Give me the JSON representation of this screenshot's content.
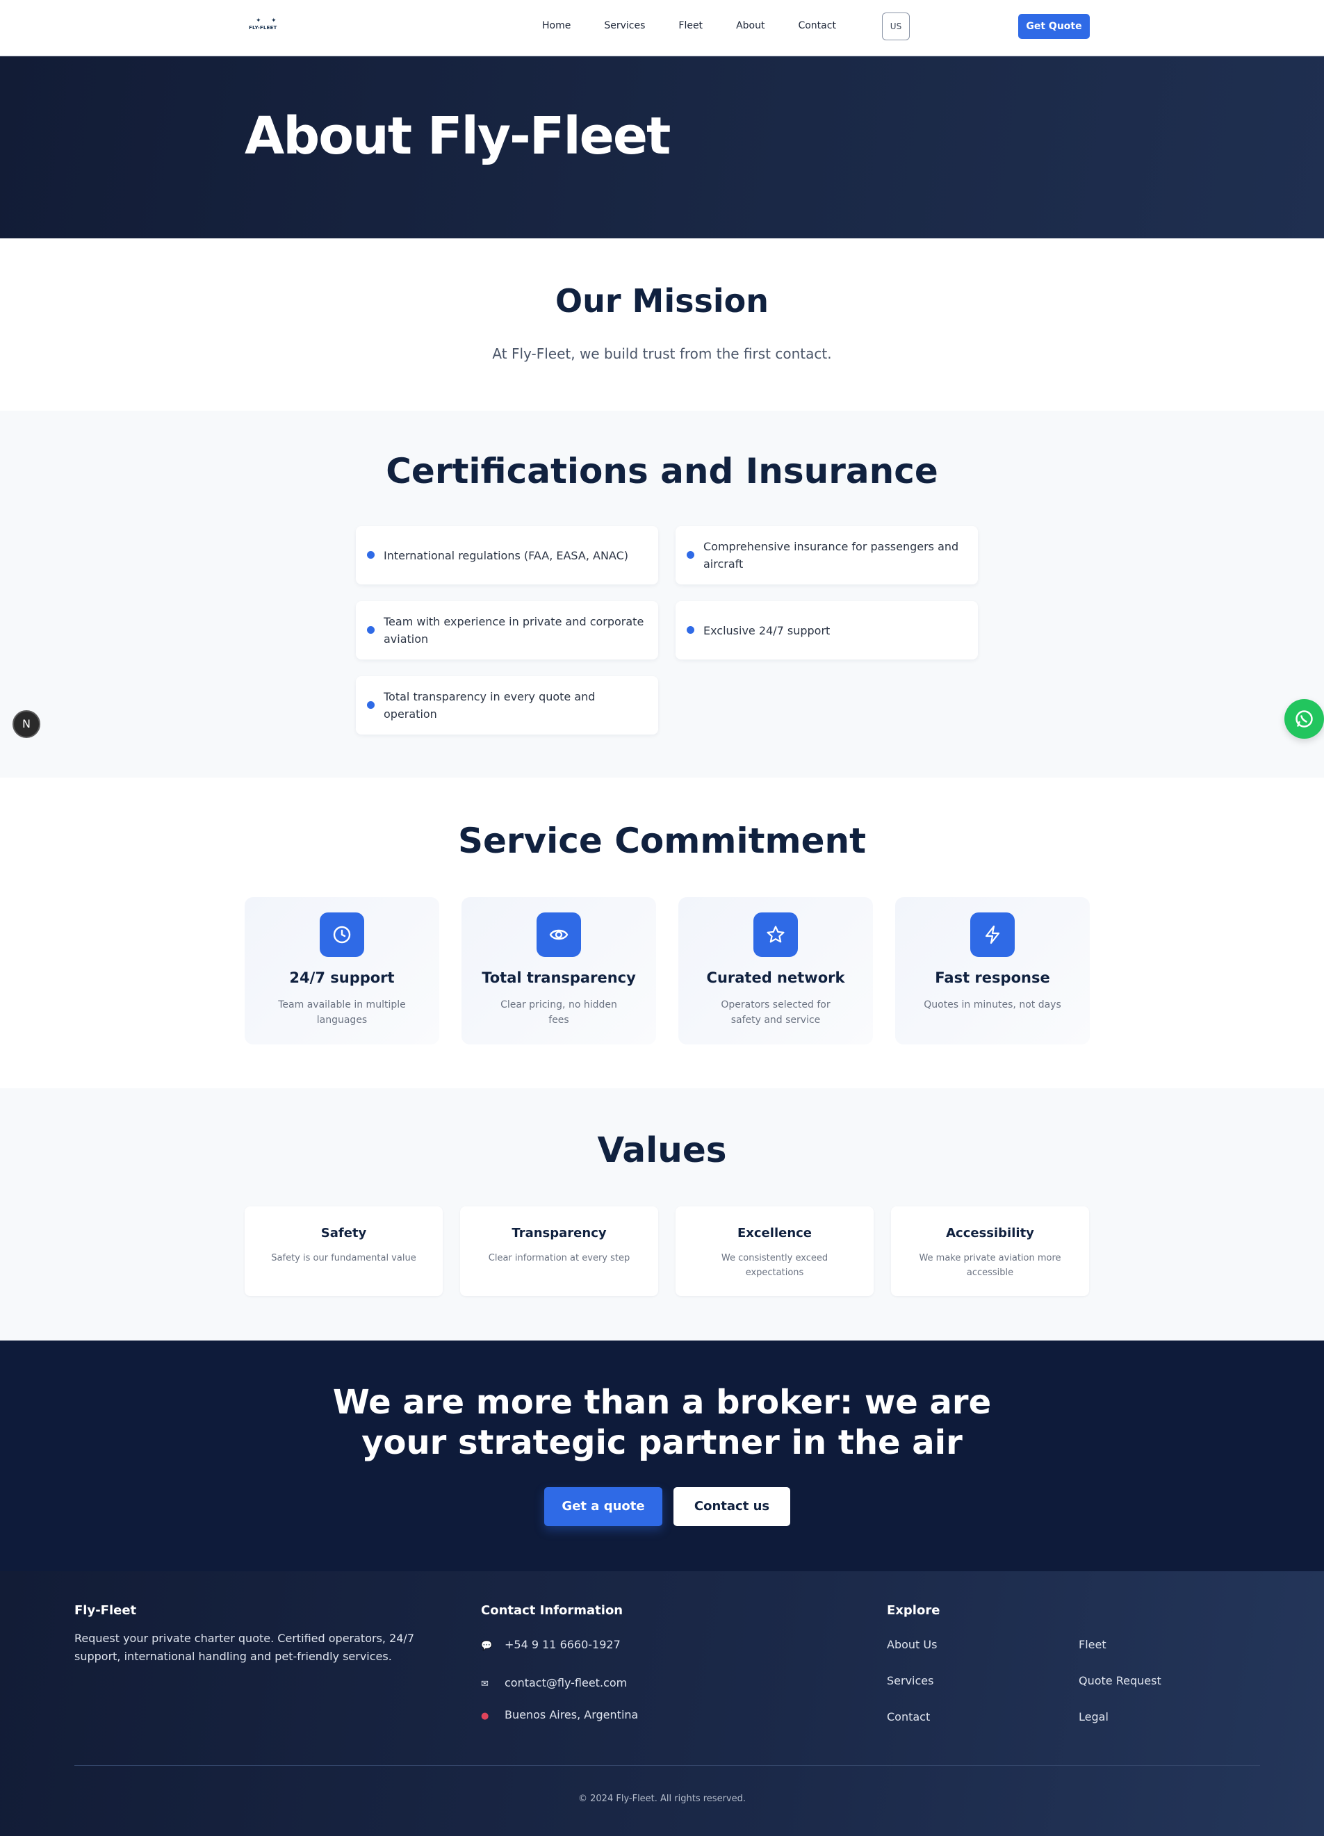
{
  "nav": {
    "logo_text": "FLY-FLEET",
    "links": [
      "Home",
      "Services",
      "Fleet",
      "About",
      "Contact"
    ],
    "lang": "US",
    "cta": "Get Quote"
  },
  "hero": {
    "title": "About Fly-Fleet"
  },
  "mission": {
    "title": "Our Mission",
    "text": "At Fly-Fleet, we build trust from the first contact."
  },
  "certs": {
    "title": "Certifications and Insurance",
    "items": [
      "International regulations (FAA, EASA, ANAC)",
      "Comprehensive insurance for passengers and aircraft",
      "Team with experience in private and corporate aviation",
      "Exclusive 24/7 support",
      "Total transparency in every quote and operation"
    ]
  },
  "badges": {
    "n": "N"
  },
  "service": {
    "title": "Service Commitment",
    "cards": [
      {
        "icon": "clock-icon",
        "title": "24/7 support",
        "text": "Team available in multiple languages"
      },
      {
        "icon": "eye-icon",
        "title": "Total transparency",
        "text": "Clear pricing, no hidden fees"
      },
      {
        "icon": "star-icon",
        "title": "Curated network",
        "text": "Operators selected for safety and service"
      },
      {
        "icon": "lightning-icon",
        "title": "Fast response",
        "text": "Quotes in minutes, not days"
      }
    ]
  },
  "values": {
    "title": "Values",
    "cards": [
      {
        "title": "Safety",
        "text": "Safety is our fundamental value"
      },
      {
        "title": "Transparency",
        "text": "Clear information at every step"
      },
      {
        "title": "Excellence",
        "text": "We consistently exceed expectations"
      },
      {
        "title": "Accessibility",
        "text": "We make private aviation more accessible"
      }
    ]
  },
  "cta": {
    "line1": "We are more than a broker: we are",
    "line2": "your strategic partner in the air",
    "primary": "Get a quote",
    "secondary": "Contact us"
  },
  "footer": {
    "brand": "Fly-Fleet",
    "description": "Request your private charter quote. Certified operators, 24/7 support, international handling and pet-friendly services.",
    "contact_title": "Contact Information",
    "phone": "+54 9 11 6660-1927",
    "email": "contact@fly-fleet.com",
    "location": "Buenos Aires, Argentina",
    "explore_title": "Explore",
    "links_col1": [
      "About Us",
      "Services",
      "Contact"
    ],
    "links_col2": [
      "Fleet",
      "Quote Request",
      "Legal"
    ],
    "copyright": "© 2024 Fly-Fleet. All rights reserved."
  },
  "colors": {
    "accent": "#2f6ae6",
    "navy": "#10213f",
    "hero_bg": "#121c36",
    "cta_bg": "#0e1b3a",
    "whatsapp": "#22c55e"
  }
}
